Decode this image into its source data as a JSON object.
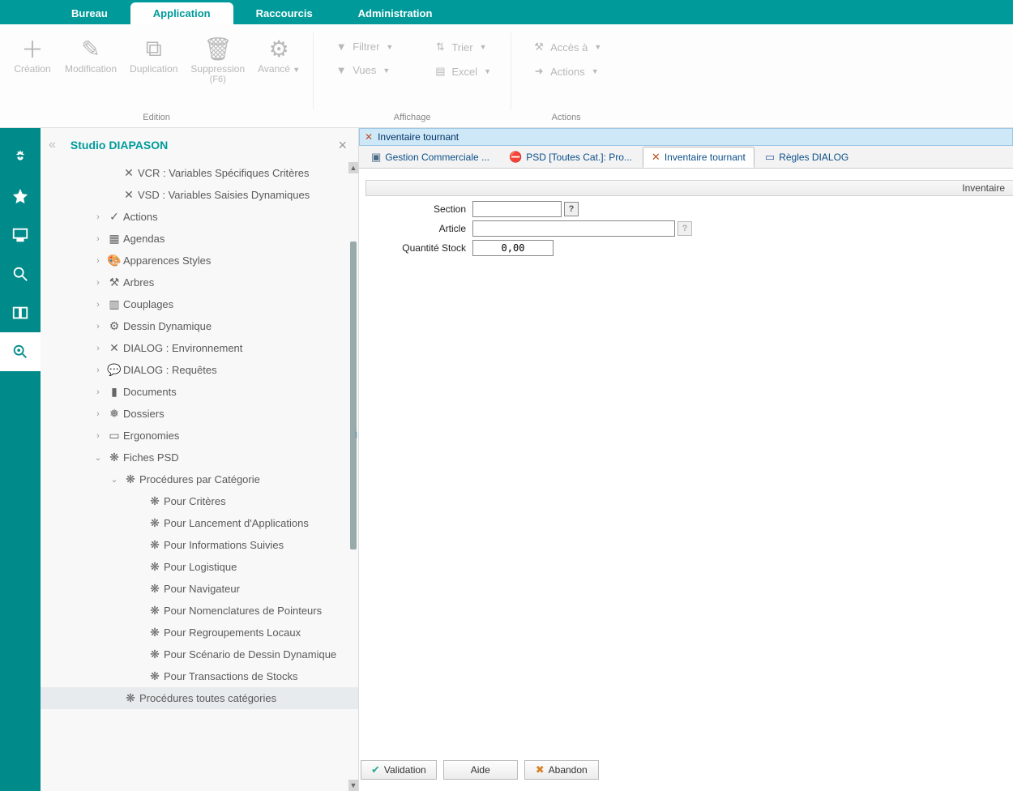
{
  "menu": {
    "tabs": [
      "Bureau",
      "Application",
      "Raccourcis",
      "Administration"
    ],
    "active": 1
  },
  "ribbon": {
    "group_edition": "Edition",
    "group_affichage": "Affichage",
    "group_actions": "Actions",
    "creation": "Création",
    "modification": "Modification",
    "duplication": "Duplication",
    "suppression": "Suppression",
    "suppression_sub": "(F6)",
    "avance": "Avancé",
    "filtrer": "Filtrer",
    "trier": "Trier",
    "vues": "Vues",
    "excel": "Excel",
    "acces": "Accès à",
    "actions": "Actions"
  },
  "tree": {
    "title": "Studio DIAPASON",
    "vcr": "VCR : Variables Spécifiques Critères",
    "vsd": "VSD : Variables Saisies Dynamiques",
    "actions": "Actions",
    "agendas": "Agendas",
    "apparences": "Apparences Styles",
    "arbres": "Arbres",
    "couplages": "Couplages",
    "dessin": "Dessin Dynamique",
    "dialog_env": "DIALOG : Environnement",
    "dialog_req": "DIALOG : Requêtes",
    "documents": "Documents",
    "dossiers": "Dossiers",
    "ergonomies": "Ergonomies",
    "fiches_psd": "Fiches PSD",
    "proc_cat": "Procédures par Catégorie",
    "pour_criteres": "Pour Critères",
    "pour_lancement": "Pour Lancement d'Applications",
    "pour_infos": "Pour Informations Suivies",
    "pour_logistique": "Pour Logistique",
    "pour_navigateur": "Pour Navigateur",
    "pour_nomenclatures": "Pour Nomenclatures de Pointeurs",
    "pour_regroupements": "Pour Regroupements Locaux",
    "pour_scenario": "Pour Scénario de Dessin Dynamique",
    "pour_transactions": "Pour Transactions de Stocks",
    "proc_toutes": "Procédures toutes catégories"
  },
  "doc": {
    "title": "Inventaire tournant",
    "tab1": "Gestion Commerciale ...",
    "tab2": "PSD [Toutes Cat.]: Pro...",
    "tab3": "Inventaire tournant",
    "tab4": "Règles DIALOG",
    "header_right": "Inventaire"
  },
  "form": {
    "section_label": "Section",
    "section_value": "",
    "article_label": "Article",
    "article_value": "",
    "qte_label": "Quantité Stock",
    "qte_value": "0,00"
  },
  "buttons": {
    "validation": "Validation",
    "aide": "Aide",
    "abandon": "Abandon"
  }
}
